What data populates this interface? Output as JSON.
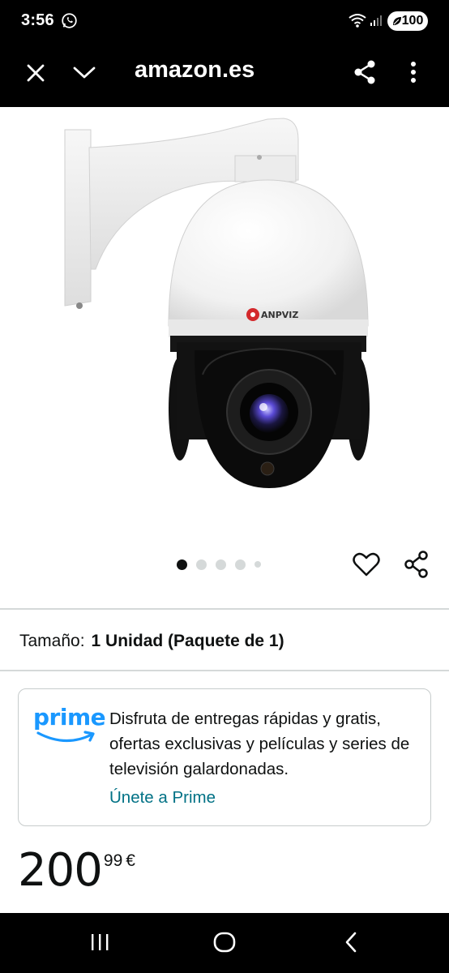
{
  "status_bar": {
    "time": "3:56",
    "battery": "100",
    "icons": [
      "whatsapp-icon",
      "wifi-icon",
      "signal-icon",
      "battery-icon"
    ]
  },
  "browser": {
    "title": "amazon.es",
    "icons": [
      "close-icon",
      "chevron-down-icon",
      "share-icon",
      "more-vert-icon"
    ]
  },
  "product": {
    "image_subject": "dome-security-camera",
    "brand_logo_text": "ANPVIZ SECURITY",
    "carousel": {
      "total": 5,
      "active_index": 0
    },
    "size_label": "Tamaño:",
    "size_value": "1 Unidad (Paquete de 1)"
  },
  "prime": {
    "logo_text": "prime",
    "description": "Disfruta de entregas rápidas y gratis, ofertas exclusivas y películas y series de televisión galardonadas.",
    "link": "Únete a Prime"
  },
  "price": {
    "whole": "200",
    "fraction": "99",
    "currency": "€"
  },
  "nav": {
    "icons": [
      "recents-icon",
      "home-icon",
      "back-icon"
    ]
  },
  "colors": {
    "prime_blue": "#1a98ff",
    "link_teal": "#007185",
    "text": "#0f1111",
    "divider": "#d5d9d9",
    "bar_background": "#000000"
  }
}
